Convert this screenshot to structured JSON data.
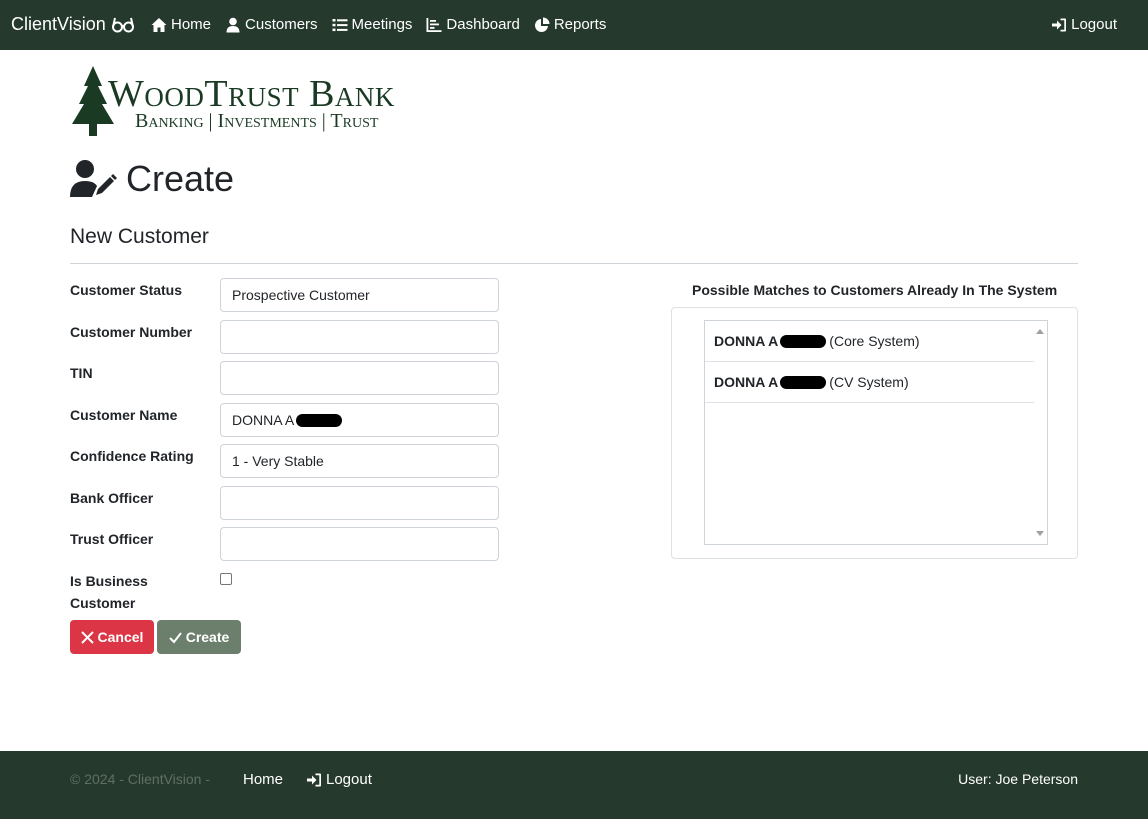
{
  "nav": {
    "brand": "ClientVision",
    "links": [
      "Home",
      "Customers",
      "Meetings",
      "Dashboard",
      "Reports"
    ],
    "logout": "Logout"
  },
  "logo": {
    "title": "WoodTrust Bank",
    "subtitle": "Banking | Investments | Trust"
  },
  "page": {
    "title": "Create",
    "subtitle": "New Customer"
  },
  "form": {
    "customer_status": {
      "label": "Customer Status",
      "value": "Prospective Customer"
    },
    "customer_number": {
      "label": "Customer Number",
      "value": ""
    },
    "tin": {
      "label": "TIN",
      "value": ""
    },
    "customer_name": {
      "label": "Customer Name",
      "value": "DONNA A"
    },
    "confidence_rating": {
      "label": "Confidence Rating",
      "value": "1 - Very Stable"
    },
    "bank_officer": {
      "label": "Bank Officer",
      "value": ""
    },
    "trust_officer": {
      "label": "Trust Officer",
      "value": ""
    },
    "is_business": {
      "label_line1": "Is Business",
      "label_line2": "Customer",
      "checked": false
    },
    "cancel_label": "Cancel",
    "create_label": "Create"
  },
  "matches": {
    "title": "Possible Matches to Customers Already In The System",
    "items": [
      {
        "name": "DONNA A",
        "source": "(Core System)"
      },
      {
        "name": "DONNA A",
        "source": "(CV System)"
      }
    ]
  },
  "footer": {
    "copyright": "© 2024 - ClientVision -",
    "home": "Home",
    "logout": "Logout",
    "user": "User: Joe Peterson"
  },
  "colors": {
    "nav_bg": "#26392d",
    "cancel": "#dc3545",
    "create": "#6b7f6c"
  }
}
